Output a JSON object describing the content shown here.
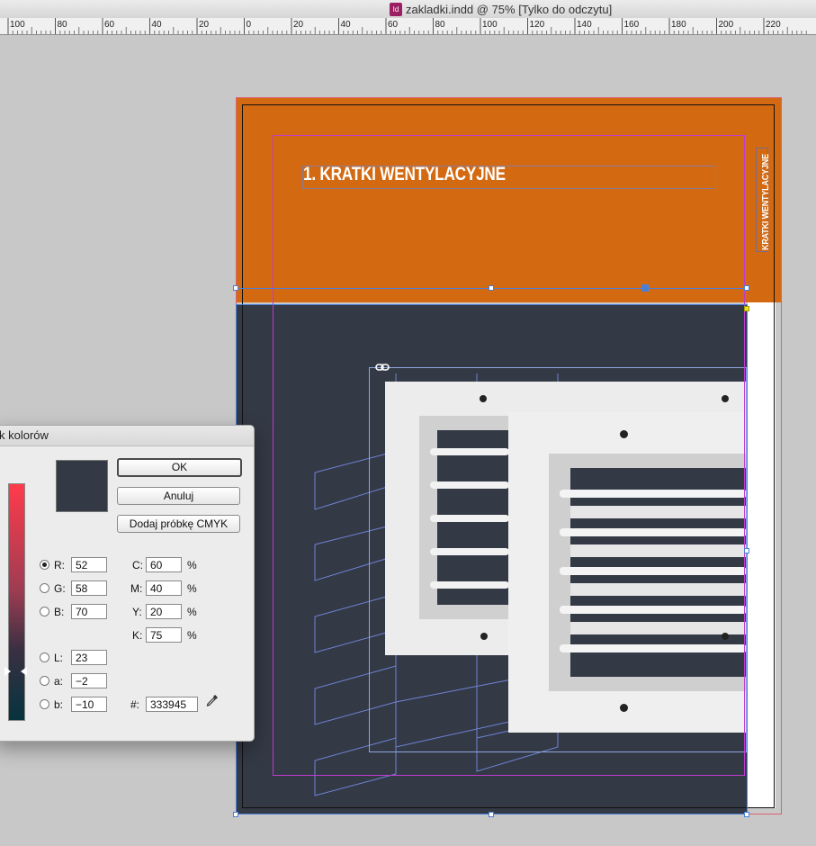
{
  "window": {
    "title": "zakladki.indd @ 75% [Tylko do odczytu]",
    "doc_icon_label": "Id"
  },
  "ruler": {
    "ticks": [
      "100",
      "80",
      "60",
      "40",
      "20",
      "0",
      "20",
      "40",
      "60",
      "80",
      "100",
      "120",
      "140",
      "160",
      "180",
      "200",
      "220"
    ]
  },
  "page": {
    "heading": "1. KRATKI WENTYLACYJNE",
    "side_label": "KRATKI WENTYLACYJNE",
    "colors": {
      "orange": "#d36a12",
      "navy": "#333945"
    }
  },
  "color_picker": {
    "title": "k kolorów",
    "swatch_color": "#333945",
    "ok_label": "OK",
    "cancel_label": "Anuluj",
    "add_cmyk_label": "Dodaj próbkę CMYK",
    "rgb": {
      "r_label": "R:",
      "r": "52",
      "g_label": "G:",
      "g": "58",
      "b_label": "B:",
      "b": "70"
    },
    "lab": {
      "l_label": "L:",
      "l": "23",
      "a_label": "a:",
      "a": "−2",
      "b_label": "b:",
      "b": "−10"
    },
    "cmyk": {
      "c_label": "C:",
      "c": "60",
      "m_label": "M:",
      "m": "40",
      "y_label": "Y:",
      "y": "20",
      "k_label": "K:",
      "k": "75",
      "unit": "%"
    },
    "hex_label": "#:",
    "hex": "333945"
  }
}
